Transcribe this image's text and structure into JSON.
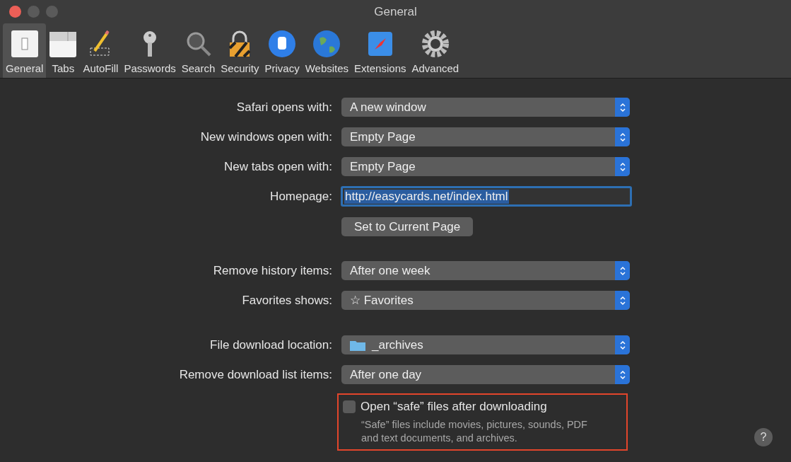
{
  "window": {
    "title": "General"
  },
  "tabs": [
    {
      "label": "General",
      "selected": true
    },
    {
      "label": "Tabs",
      "selected": false
    },
    {
      "label": "AutoFill",
      "selected": false
    },
    {
      "label": "Passwords",
      "selected": false
    },
    {
      "label": "Search",
      "selected": false
    },
    {
      "label": "Security",
      "selected": false
    },
    {
      "label": "Privacy",
      "selected": false
    },
    {
      "label": "Websites",
      "selected": false
    },
    {
      "label": "Extensions",
      "selected": false
    },
    {
      "label": "Advanced",
      "selected": false
    }
  ],
  "groups": [
    [
      {
        "kind": "popup",
        "label": "Safari opens with:",
        "value": "A new window"
      },
      {
        "kind": "popup",
        "label": "New windows open with:",
        "value": "Empty Page"
      },
      {
        "kind": "popup",
        "label": "New tabs open with:",
        "value": "Empty Page"
      },
      {
        "kind": "field",
        "label": "Homepage:",
        "value": "http://easycards.net/index.html",
        "selected": true
      },
      {
        "kind": "button",
        "value": "Set to Current Page"
      }
    ],
    [
      {
        "kind": "popup",
        "label": "Remove history items:",
        "value": "After one week"
      },
      {
        "kind": "popup",
        "label": "Favorites shows:",
        "value": "☆ Favorites"
      }
    ],
    [
      {
        "kind": "folder-popup",
        "label": "File download location:",
        "value": "_archives"
      },
      {
        "kind": "popup",
        "label": "Remove download list items:",
        "value": "After one day"
      },
      {
        "kind": "checkbox",
        "value": "Open “safe” files after downloading",
        "checked": false,
        "highlighted": true,
        "note": "“Safe” files include movies, pictures, sounds, PDF and text documents, and archives."
      }
    ]
  ],
  "help": {
    "label": "?"
  }
}
